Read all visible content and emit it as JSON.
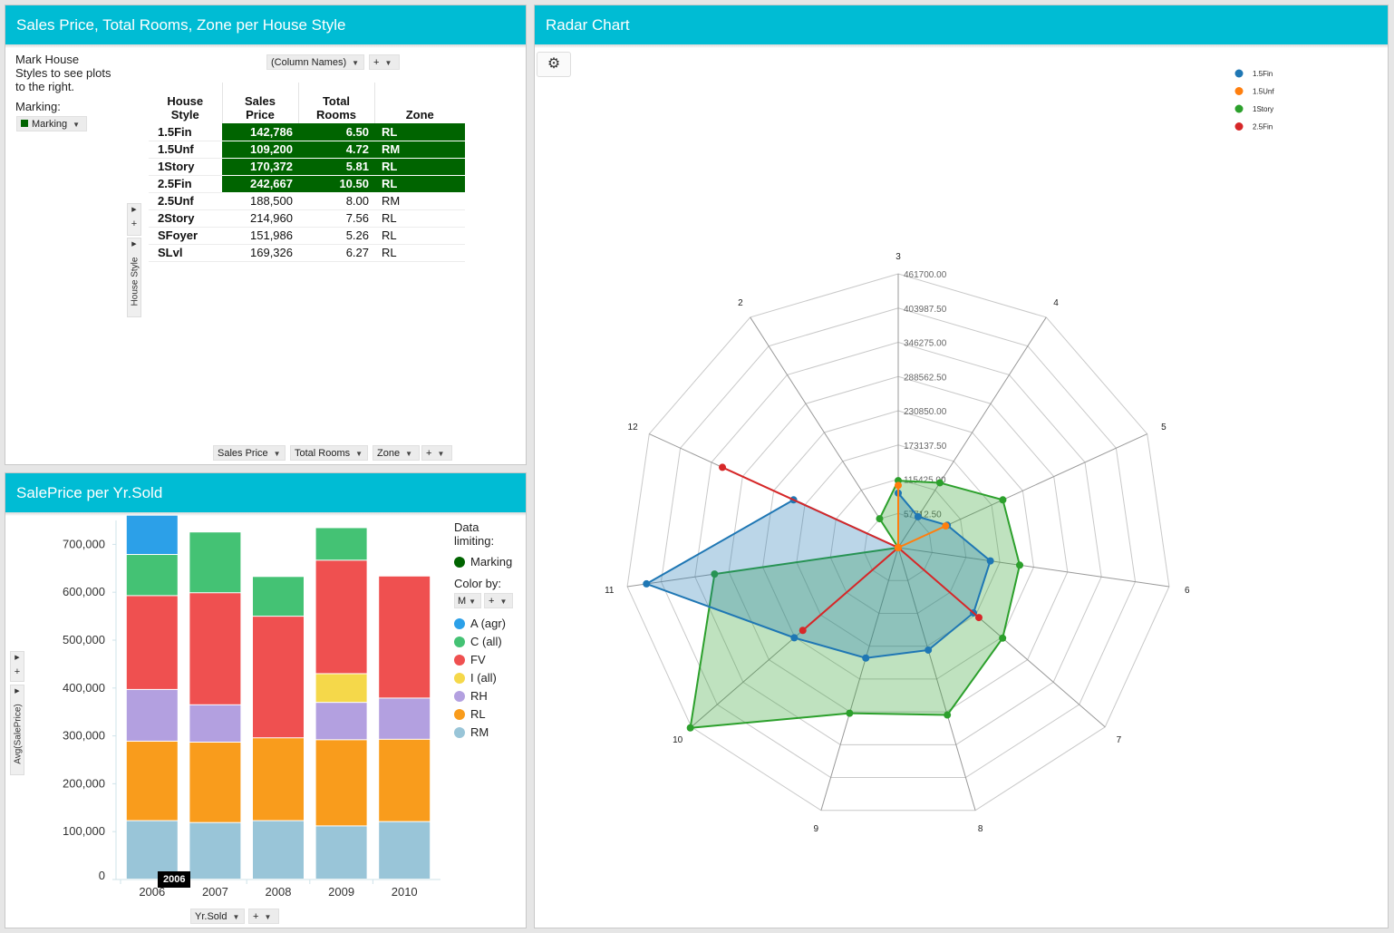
{
  "panels": {
    "crosstab": {
      "title": "Sales Price, Total Rooms, Zone per House Style",
      "hint": [
        "Mark House",
        "Styles to see plots",
        "to the right."
      ],
      "marking_label": "Marking:",
      "marking_value": "Marking",
      "column_names_dd": "(Column Names)",
      "plus": "+",
      "row_axis_label": "House Style",
      "headers": {
        "house_style": [
          "House",
          "Style"
        ],
        "sales_price": [
          "Sales",
          "Price"
        ],
        "total_rooms": [
          "Total",
          "Rooms"
        ],
        "zone": "Zone"
      },
      "rows": [
        {
          "style": "1.5Fin",
          "price": "142,786",
          "rooms": "6.50",
          "zone": "RL",
          "marked": true
        },
        {
          "style": "1.5Unf",
          "price": "109,200",
          "rooms": "4.72",
          "zone": "RM",
          "marked": true
        },
        {
          "style": "1Story",
          "price": "170,372",
          "rooms": "5.81",
          "zone": "RL",
          "marked": true
        },
        {
          "style": "2.5Fin",
          "price": "242,667",
          "rooms": "10.50",
          "zone": "RL",
          "marked": true
        },
        {
          "style": "2.5Unf",
          "price": "188,500",
          "rooms": "8.00",
          "zone": "RM",
          "marked": false
        },
        {
          "style": "2Story",
          "price": "214,960",
          "rooms": "7.56",
          "zone": "RL",
          "marked": false
        },
        {
          "style": "SFoyer",
          "price": "151,986",
          "rooms": "5.26",
          "zone": "RL",
          "marked": false
        },
        {
          "style": "SLvl",
          "price": "169,326",
          "rooms": "6.27",
          "zone": "RL",
          "marked": false
        }
      ],
      "bottom_dds": [
        "Sales Price",
        "Total Rooms",
        "Zone"
      ]
    },
    "bar": {
      "title": "SalePrice per Yr.Sold",
      "y_axis_label": "Avg(SalePrice)",
      "x_axis_dd": "Yr.Sold",
      "tooltip": "2006",
      "legend": {
        "data_limiting": [
          "Data",
          "limiting:"
        ],
        "marking": "Marking",
        "color_by": "Color by:",
        "color_dd": "M",
        "items": [
          {
            "label": "A (agr)",
            "color": "#2ca0e8"
          },
          {
            "label": "C (all)",
            "color": "#44c274"
          },
          {
            "label": "FV",
            "color": "#ef5050"
          },
          {
            "label": "I (all)",
            "color": "#f5d84a"
          },
          {
            "label": "RH",
            "color": "#b3a0e0"
          },
          {
            "label": "RL",
            "color": "#f99c1c"
          },
          {
            "label": "RM",
            "color": "#99c5d8"
          }
        ]
      }
    },
    "radar": {
      "title": "Radar Chart",
      "gear": "gear-icon"
    }
  },
  "chart_data": [
    {
      "type": "bar",
      "stacked": true,
      "categories": [
        "2006",
        "2007",
        "2008",
        "2009",
        "2010"
      ],
      "ylabel": "Avg(SalePrice)",
      "xlabel": "Yr.Sold",
      "ylim": [
        0,
        750000
      ],
      "yticks": [
        "0",
        "100,000",
        "200,000",
        "300,000",
        "400,000",
        "500,000",
        "600,000",
        "700,000"
      ],
      "series": [
        {
          "name": "RM",
          "color": "#99c5d8",
          "values": [
            122000,
            118000,
            122000,
            111000,
            120000
          ]
        },
        {
          "name": "RL",
          "color": "#f99c1c",
          "values": [
            166000,
            168000,
            173000,
            180000,
            172000
          ]
        },
        {
          "name": "RH",
          "color": "#b3a0e0",
          "values": [
            108000,
            78000,
            0,
            78000,
            86000
          ]
        },
        {
          "name": "I (all)",
          "color": "#f5d84a",
          "values": [
            0,
            0,
            0,
            60000,
            0
          ]
        },
        {
          "name": "FV",
          "color": "#ef5050",
          "values": [
            196000,
            234000,
            254000,
            237000,
            255000
          ]
        },
        {
          "name": "C (all)",
          "color": "#44c274",
          "values": [
            86000,
            127000,
            83000,
            68000,
            0
          ]
        },
        {
          "name": "A (agr)",
          "color": "#2ca0e8",
          "values": [
            82000,
            0,
            0,
            0,
            0
          ]
        }
      ]
    },
    {
      "type": "radar",
      "axes": [
        "3",
        "4",
        "5",
        "6",
        "7",
        "8",
        "9",
        "10",
        "11",
        "12",
        "2"
      ],
      "rlim": [
        0,
        461700
      ],
      "rticks": [
        "57712.50",
        "115425.00",
        "173137.50",
        "230850.00",
        "288562.50",
        "346275.00",
        "403987.50",
        "461700.00"
      ],
      "series": [
        {
          "name": "1.5Fin",
          "color": "#1f77b4",
          "values": [
            92000,
            62000,
            91000,
            157000,
            168000,
            180000,
            194000,
            232000,
            429000,
            194000,
            0
          ]
        },
        {
          "name": "1.5Unf",
          "color": "#ff7f0e",
          "values": [
            105000,
            0,
            88000,
            0,
            0,
            0,
            0,
            0,
            0,
            0,
            0
          ]
        },
        {
          "name": "1Story",
          "color": "#2ca02c",
          "values": [
            113000,
            130000,
            194000,
            207000,
            233000,
            294000,
            291000,
            464000,
            313000,
            0,
            58000
          ]
        },
        {
          "name": "2.5Fin",
          "color": "#d62728",
          "values": [
            0,
            0,
            0,
            0,
            180000,
            0,
            0,
            213000,
            0,
            326000,
            0
          ]
        }
      ]
    }
  ]
}
